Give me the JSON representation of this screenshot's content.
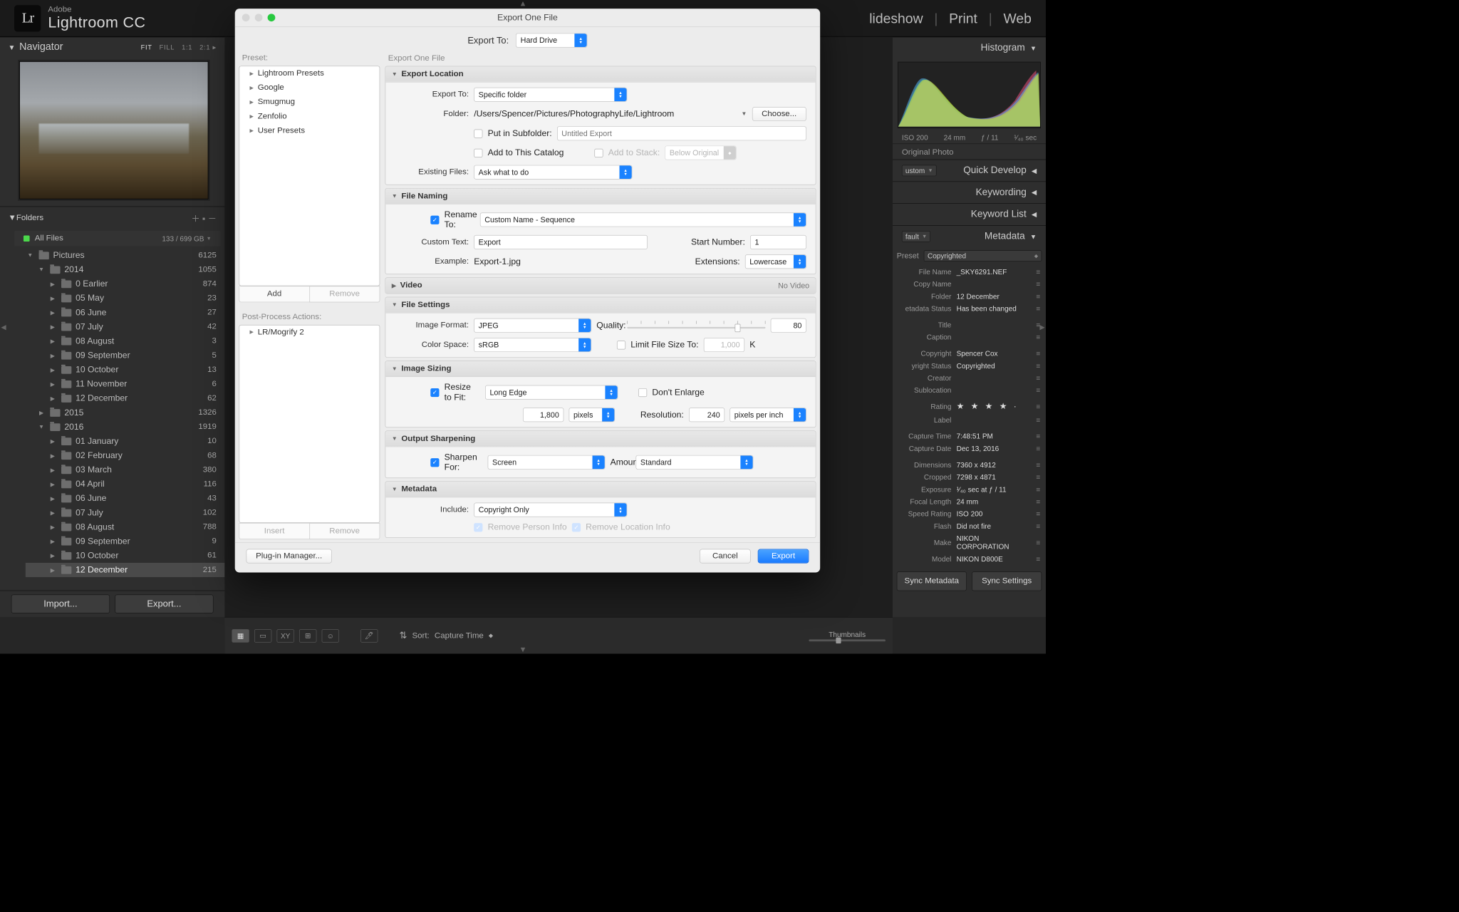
{
  "brand": {
    "adobe": "Adobe",
    "app": "Lightroom CC",
    "logo": "Lr"
  },
  "modules": [
    "lideshow",
    "Print",
    "Web"
  ],
  "navigator": {
    "title": "Navigator",
    "opts": {
      "fit": "FIT",
      "fill": "FILL",
      "one": "1:1",
      "two": "2:1"
    },
    "folders_title": "Folders",
    "drive": {
      "name": "All Files",
      "size": "133 / 699 GB"
    }
  },
  "tree": [
    {
      "ind": 0,
      "tw": "▼",
      "name": "Pictures",
      "count": "6125"
    },
    {
      "ind": 1,
      "tw": "▼",
      "name": "2014",
      "count": "1055"
    },
    {
      "ind": 2,
      "tw": "▶",
      "name": "0 Earlier",
      "count": "874"
    },
    {
      "ind": 2,
      "tw": "▶",
      "name": "05 May",
      "count": "23"
    },
    {
      "ind": 2,
      "tw": "▶",
      "name": "06 June",
      "count": "27"
    },
    {
      "ind": 2,
      "tw": "▶",
      "name": "07 July",
      "count": "42"
    },
    {
      "ind": 2,
      "tw": "▶",
      "name": "08 August",
      "count": "3"
    },
    {
      "ind": 2,
      "tw": "▶",
      "name": "09 September",
      "count": "5"
    },
    {
      "ind": 2,
      "tw": "▶",
      "name": "10 October",
      "count": "13"
    },
    {
      "ind": 2,
      "tw": "▶",
      "name": "11 November",
      "count": "6"
    },
    {
      "ind": 2,
      "tw": "▶",
      "name": "12 December",
      "count": "62"
    },
    {
      "ind": 1,
      "tw": "▶",
      "name": "2015",
      "count": "1326"
    },
    {
      "ind": 1,
      "tw": "▼",
      "name": "2016",
      "count": "1919"
    },
    {
      "ind": 2,
      "tw": "▶",
      "name": "01 January",
      "count": "10"
    },
    {
      "ind": 2,
      "tw": "▶",
      "name": "02 February",
      "count": "68"
    },
    {
      "ind": 2,
      "tw": "▶",
      "name": "03 March",
      "count": "380"
    },
    {
      "ind": 2,
      "tw": "▶",
      "name": "04 April",
      "count": "116"
    },
    {
      "ind": 2,
      "tw": "▶",
      "name": "06 June",
      "count": "43"
    },
    {
      "ind": 2,
      "tw": "▶",
      "name": "07 July",
      "count": "102"
    },
    {
      "ind": 2,
      "tw": "▶",
      "name": "08 August",
      "count": "788"
    },
    {
      "ind": 2,
      "tw": "▶",
      "name": "09 September",
      "count": "9"
    },
    {
      "ind": 2,
      "tw": "▶",
      "name": "10 October",
      "count": "61"
    },
    {
      "ind": 2,
      "tw": "▶",
      "name": "12 December",
      "count": "215",
      "sel": true
    }
  ],
  "left_buttons": {
    "import": "Import...",
    "export": "Export..."
  },
  "toolbar": {
    "sort_label": "Sort:",
    "sort_value": "Capture Time",
    "thumbs": "Thumbnails"
  },
  "right": {
    "histogram": "Histogram",
    "histo_info": {
      "iso": "ISO 200",
      "fl": "24 mm",
      "ap": "ƒ / 11",
      "ss": "¹⁄₄₀ sec"
    },
    "orig": "Original Photo",
    "custom": "ustom",
    "quick": "Quick Develop",
    "keywording": "Keywording",
    "keywordlist": "Keyword List",
    "default": "fault",
    "metadata_label": "Metadata",
    "preset_label": "Preset",
    "preset_value": "Copyrighted",
    "meta": [
      {
        "l": "File Name",
        "v": "_SKY6291.NEF"
      },
      {
        "l": "Copy Name",
        "v": ""
      },
      {
        "l": "Folder",
        "v": "12 December"
      },
      {
        "l": "etadata Status",
        "v": "Has been changed"
      }
    ],
    "meta2": [
      {
        "l": "Title",
        "v": ""
      },
      {
        "l": "Caption",
        "v": ""
      }
    ],
    "meta3": [
      {
        "l": "Copyright",
        "v": "Spencer Cox"
      },
      {
        "l": "yright Status",
        "v": "Copyrighted"
      },
      {
        "l": "Creator",
        "v": ""
      },
      {
        "l": "Sublocation",
        "v": ""
      }
    ],
    "rating_label": "Rating",
    "rating_stars": "★ ★ ★ ★ ·",
    "label_label": "Label",
    "meta4": [
      {
        "l": "Capture Time",
        "v": "7:48:51 PM"
      },
      {
        "l": "Capture Date",
        "v": "Dec 13, 2016"
      }
    ],
    "meta5": [
      {
        "l": "Dimensions",
        "v": "7360 x 4912"
      },
      {
        "l": "Cropped",
        "v": "7298 x 4871"
      },
      {
        "l": "Exposure",
        "v": "¹⁄₄₀ sec at ƒ / 11"
      },
      {
        "l": "Focal Length",
        "v": "24 mm"
      },
      {
        "l": "Speed Rating",
        "v": "ISO 200"
      },
      {
        "l": "Flash",
        "v": "Did not fire"
      },
      {
        "l": "Make",
        "v": "NIKON CORPORATION"
      },
      {
        "l": "Model",
        "v": "NIKON D800E"
      }
    ],
    "sync_meta": "Sync Metadata",
    "sync_set": "Sync Settings"
  },
  "dialog": {
    "title": "Export One File",
    "export_to_label": "Export To:",
    "export_to_value": "Hard Drive",
    "preset_label": "Preset:",
    "right_title": "Export One File",
    "presets": [
      "Lightroom Presets",
      "Google",
      "Smugmug",
      "Zenfolio",
      "User Presets"
    ],
    "add": "Add",
    "remove": "Remove",
    "pp_label": "Post-Process Actions:",
    "pp_items": [
      "LR/Mogrify 2"
    ],
    "insert": "Insert",
    "sections": {
      "location": {
        "title": "Export Location",
        "export_to_label": "Export To:",
        "export_to_value": "Specific folder",
        "folder_label": "Folder:",
        "folder_value": "/Users/Spencer/Pictures/PhotographyLife/Lightroom",
        "choose": "Choose...",
        "subfolder_label": "Put in Subfolder:",
        "subfolder_placeholder": "Untitled Export",
        "add_catalog": "Add to This Catalog",
        "add_stack": "Add to Stack:",
        "stack_value": "Below Original",
        "existing_label": "Existing Files:",
        "existing_value": "Ask what to do"
      },
      "naming": {
        "title": "File Naming",
        "rename_label": "Rename To:",
        "rename_value": "Custom Name - Sequence",
        "custom_label": "Custom Text:",
        "custom_value": "Export",
        "start_label": "Start Number:",
        "start_value": "1",
        "example_label": "Example:",
        "example_value": "Export-1.jpg",
        "ext_label": "Extensions:",
        "ext_value": "Lowercase"
      },
      "video": {
        "title": "Video",
        "right": "No Video"
      },
      "settings": {
        "title": "File Settings",
        "format_label": "Image Format:",
        "format_value": "JPEG",
        "quality_label": "Quality:",
        "quality_value": "80",
        "cs_label": "Color Space:",
        "cs_value": "sRGB",
        "limit_label": "Limit File Size To:",
        "limit_value": "1,000",
        "limit_unit": "K"
      },
      "sizing": {
        "title": "Image Sizing",
        "resize_label": "Resize to Fit:",
        "resize_value": "Long Edge",
        "dont_enlarge": "Don't Enlarge",
        "dim_value": "1,800",
        "dim_unit": "pixels",
        "res_label": "Resolution:",
        "res_value": "240",
        "res_unit": "pixels per inch"
      },
      "sharpen": {
        "title": "Output Sharpening",
        "for_label": "Sharpen For:",
        "for_value": "Screen",
        "amount_label": "Amount:",
        "amount_value": "Standard"
      },
      "metadata": {
        "title": "Metadata",
        "include_label": "Include:",
        "include_value": "Copyright Only",
        "rm_person": "Remove Person Info",
        "rm_loc": "Remove Location Info"
      }
    },
    "plugin": "Plug-in Manager...",
    "cancel": "Cancel",
    "export": "Export"
  }
}
